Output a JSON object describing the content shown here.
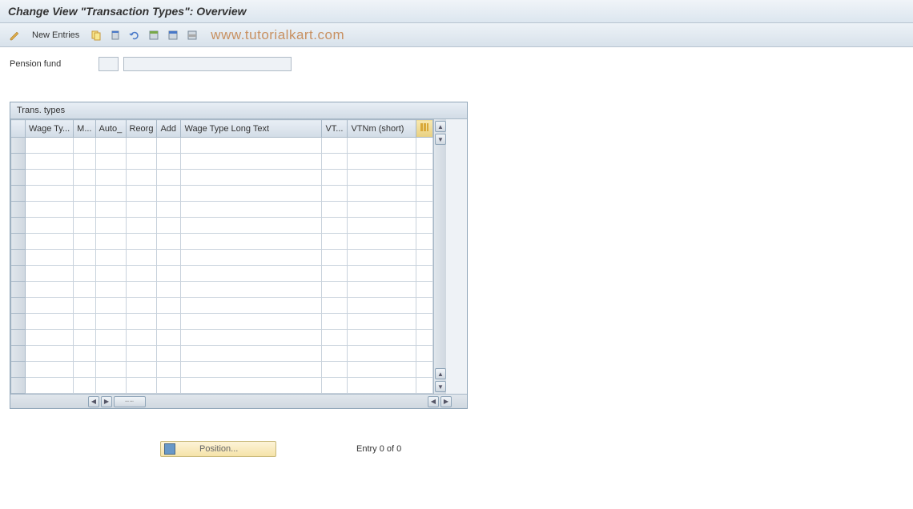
{
  "header": {
    "title": "Change View \"Transaction Types\": Overview"
  },
  "toolbar": {
    "new_entries_label": "New Entries"
  },
  "watermark": "www.tutorialkart.com",
  "form": {
    "pension_fund_label": "Pension fund",
    "pension_fund_code": "",
    "pension_fund_desc": ""
  },
  "grid": {
    "title": "Trans. types",
    "columns": [
      "Wage Ty...",
      "M...",
      "Auto_",
      "Reorg",
      "Add",
      "Wage Type Long Text",
      "VT...",
      "VTNm (short)"
    ],
    "row_count": 16
  },
  "footer": {
    "position_label": "Position...",
    "entry_status": "Entry 0 of 0"
  }
}
